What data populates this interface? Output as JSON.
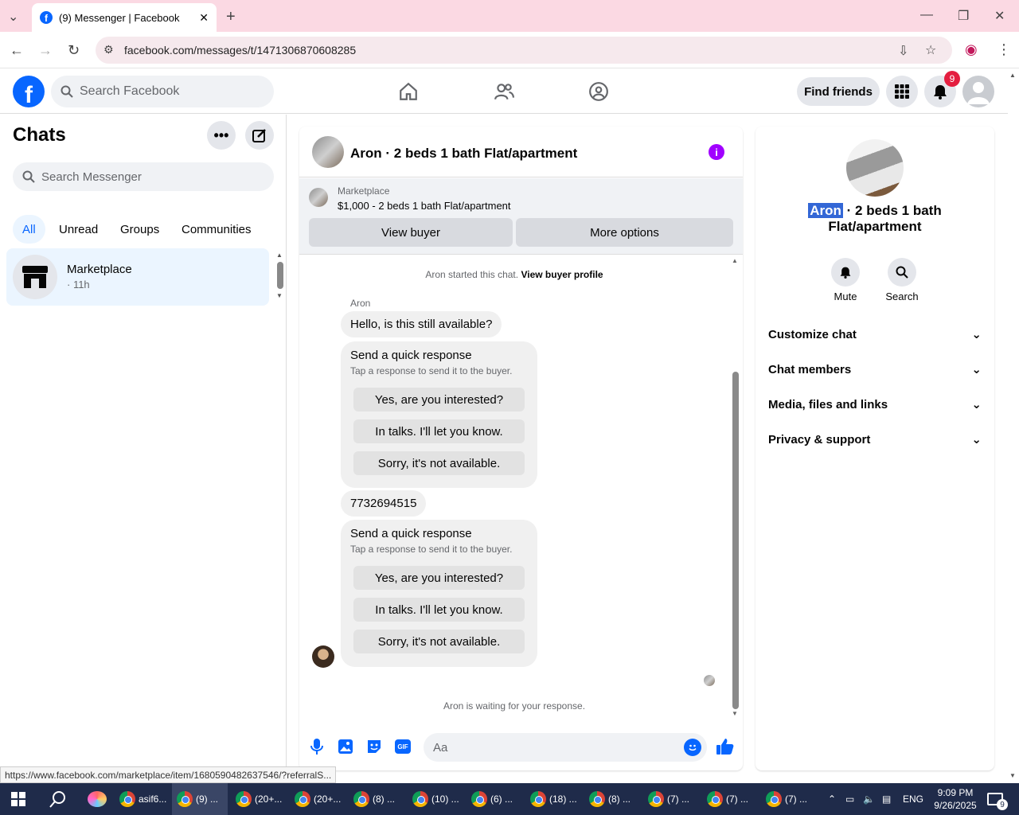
{
  "browser": {
    "tab_title": "(9) Messenger | Facebook",
    "url": "facebook.com/messages/t/1471306870608285",
    "status_url": "https://www.facebook.com/marketplace/item/1680590482637546/?referralS..."
  },
  "fb_header": {
    "search_placeholder": "Search Facebook",
    "find_friends": "Find friends",
    "notification_count": "9"
  },
  "left": {
    "title": "Chats",
    "search_placeholder": "Search Messenger",
    "filters": [
      "All",
      "Unread",
      "Groups",
      "Communities"
    ],
    "chat": {
      "name": "Marketplace",
      "time": "· 11h"
    }
  },
  "conversation": {
    "title": "Aron · 2 beds 1 bath Flat/apartment",
    "marketplace_label": "Marketplace",
    "listing": "$1,000 - 2 beds 1 bath Flat/apartment",
    "view_buyer": "View buyer",
    "more_options": "More options",
    "started_text": "Aron started this chat.",
    "view_buyer_profile": "View buyer profile",
    "sender": "Aron",
    "msg1": "Hello, is this still available?",
    "msg2": "7732694515",
    "quick": {
      "title": "Send a quick response",
      "subtitle": "Tap a response to send it to the buyer.",
      "r1": "Yes, are you interested?",
      "r2": "In talks. I'll let you know.",
      "r3": "Sorry, it's not available."
    },
    "waiting": "Aron is waiting for your response.",
    "input_placeholder": "Aa"
  },
  "right": {
    "name_highlight": "Aron",
    "name_rest": " · 2 beds 1 bath",
    "name_line2": "Flat/apartment",
    "mute": "Mute",
    "search": "Search",
    "rows": [
      "Customize chat",
      "Chat members",
      "Media, files and links",
      "Privacy & support"
    ]
  },
  "taskbar": {
    "items": [
      "asif6...",
      "(9) ...",
      "(20+...",
      "(20+...",
      "(8) ...",
      "(10) ...",
      "(6) ...",
      "(18) ...",
      "(8) ...",
      "(7) ...",
      "(7) ...",
      "(7) ..."
    ],
    "lang": "ENG",
    "time": "9:09 PM",
    "date": "9/26/2025",
    "notif": "9"
  }
}
